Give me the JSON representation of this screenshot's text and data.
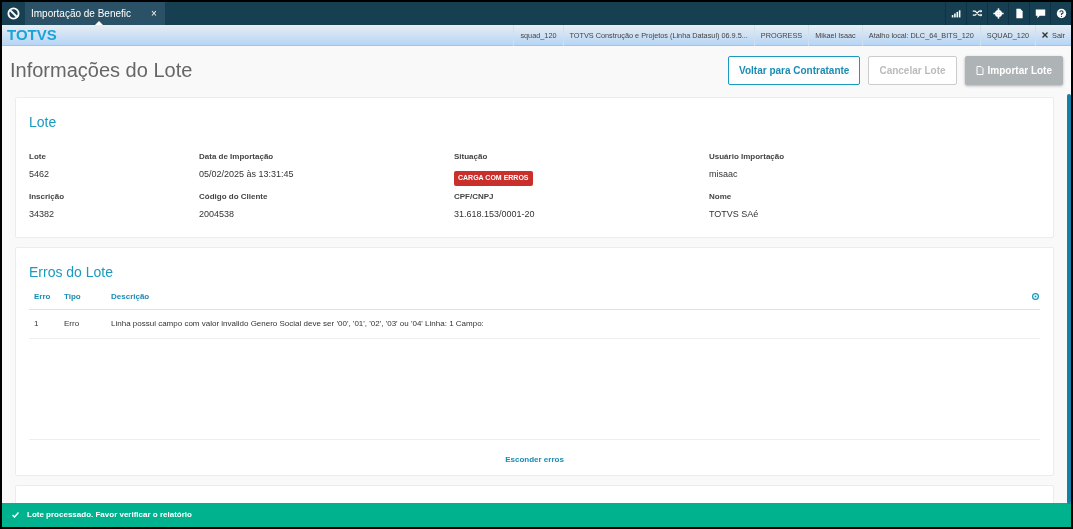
{
  "tabs": [
    {
      "label": "Importação de Benefic",
      "selected": true,
      "close": "×"
    }
  ],
  "header": {
    "brand": "TOTVS",
    "items": [
      "squad_120",
      "TOTVS Construção e Projetos (Linha Datasul) 06.9.5...",
      "PROGRESS",
      "Mikael Isaac",
      "Atalho local: DLC_64_BITS_120",
      "SQUAD_120"
    ],
    "logout": "Sair"
  },
  "page": {
    "title": "Informações do Lote",
    "buttons": [
      {
        "label": "Voltar para Contratante",
        "kind": "outline",
        "disabled": false
      },
      {
        "label": "Cancelar Lote",
        "kind": "outline",
        "disabled": true
      },
      {
        "label": "Importar Lote",
        "kind": "filled",
        "disabled": true
      }
    ]
  },
  "lote": {
    "title": "Lote",
    "fields": [
      {
        "label": "Lote",
        "value": "5462",
        "kind": "text"
      },
      {
        "label": "Data de Importação",
        "value": "05/02/2025 às 13:31:45",
        "kind": "text"
      },
      {
        "label": "Situação",
        "value": "CARGA COM ERROS",
        "kind": "badge",
        "color": "#c9302c"
      },
      {
        "label": "Usuário Importação",
        "value": "misaac",
        "kind": "text"
      },
      {
        "label": "Inscrição",
        "value": "34382",
        "kind": "text"
      },
      {
        "label": "Código do Cliente",
        "value": "2004538",
        "kind": "text"
      },
      {
        "label": "CPF/CNPJ",
        "value": "31.618.153/0001-20",
        "kind": "text"
      },
      {
        "label": "Nome",
        "value": "TOTVS SAé",
        "kind": "text"
      }
    ]
  },
  "errors": {
    "title": "Erros do Lote",
    "columns": [
      "Erro",
      "Tipo",
      "Descrição"
    ],
    "rows": [
      [
        "1",
        "Erro",
        "Linha possui campo com valor invalido Genero Social deve ser '00', '01', '02', '03' ou '04' Linha: 1 Campo:"
      ]
    ],
    "hide_link": "Esconder erros"
  },
  "toast": {
    "message": "Lote processado. Favor verificar o relatório"
  }
}
